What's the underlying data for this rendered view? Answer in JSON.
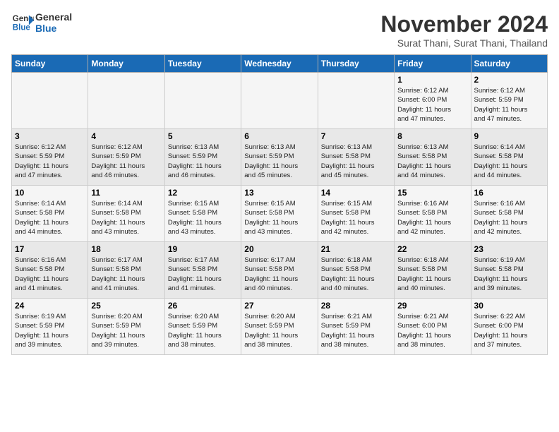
{
  "header": {
    "logo_line1": "General",
    "logo_line2": "Blue",
    "month": "November 2024",
    "location": "Surat Thani, Surat Thani, Thailand"
  },
  "days_of_week": [
    "Sunday",
    "Monday",
    "Tuesday",
    "Wednesday",
    "Thursday",
    "Friday",
    "Saturday"
  ],
  "weeks": [
    [
      {
        "day": "",
        "info": ""
      },
      {
        "day": "",
        "info": ""
      },
      {
        "day": "",
        "info": ""
      },
      {
        "day": "",
        "info": ""
      },
      {
        "day": "",
        "info": ""
      },
      {
        "day": "1",
        "info": "Sunrise: 6:12 AM\nSunset: 6:00 PM\nDaylight: 11 hours\nand 47 minutes."
      },
      {
        "day": "2",
        "info": "Sunrise: 6:12 AM\nSunset: 5:59 PM\nDaylight: 11 hours\nand 47 minutes."
      }
    ],
    [
      {
        "day": "3",
        "info": "Sunrise: 6:12 AM\nSunset: 5:59 PM\nDaylight: 11 hours\nand 47 minutes."
      },
      {
        "day": "4",
        "info": "Sunrise: 6:12 AM\nSunset: 5:59 PM\nDaylight: 11 hours\nand 46 minutes."
      },
      {
        "day": "5",
        "info": "Sunrise: 6:13 AM\nSunset: 5:59 PM\nDaylight: 11 hours\nand 46 minutes."
      },
      {
        "day": "6",
        "info": "Sunrise: 6:13 AM\nSunset: 5:59 PM\nDaylight: 11 hours\nand 45 minutes."
      },
      {
        "day": "7",
        "info": "Sunrise: 6:13 AM\nSunset: 5:58 PM\nDaylight: 11 hours\nand 45 minutes."
      },
      {
        "day": "8",
        "info": "Sunrise: 6:13 AM\nSunset: 5:58 PM\nDaylight: 11 hours\nand 44 minutes."
      },
      {
        "day": "9",
        "info": "Sunrise: 6:14 AM\nSunset: 5:58 PM\nDaylight: 11 hours\nand 44 minutes."
      }
    ],
    [
      {
        "day": "10",
        "info": "Sunrise: 6:14 AM\nSunset: 5:58 PM\nDaylight: 11 hours\nand 44 minutes."
      },
      {
        "day": "11",
        "info": "Sunrise: 6:14 AM\nSunset: 5:58 PM\nDaylight: 11 hours\nand 43 minutes."
      },
      {
        "day": "12",
        "info": "Sunrise: 6:15 AM\nSunset: 5:58 PM\nDaylight: 11 hours\nand 43 minutes."
      },
      {
        "day": "13",
        "info": "Sunrise: 6:15 AM\nSunset: 5:58 PM\nDaylight: 11 hours\nand 43 minutes."
      },
      {
        "day": "14",
        "info": "Sunrise: 6:15 AM\nSunset: 5:58 PM\nDaylight: 11 hours\nand 42 minutes."
      },
      {
        "day": "15",
        "info": "Sunrise: 6:16 AM\nSunset: 5:58 PM\nDaylight: 11 hours\nand 42 minutes."
      },
      {
        "day": "16",
        "info": "Sunrise: 6:16 AM\nSunset: 5:58 PM\nDaylight: 11 hours\nand 42 minutes."
      }
    ],
    [
      {
        "day": "17",
        "info": "Sunrise: 6:16 AM\nSunset: 5:58 PM\nDaylight: 11 hours\nand 41 minutes."
      },
      {
        "day": "18",
        "info": "Sunrise: 6:17 AM\nSunset: 5:58 PM\nDaylight: 11 hours\nand 41 minutes."
      },
      {
        "day": "19",
        "info": "Sunrise: 6:17 AM\nSunset: 5:58 PM\nDaylight: 11 hours\nand 41 minutes."
      },
      {
        "day": "20",
        "info": "Sunrise: 6:17 AM\nSunset: 5:58 PM\nDaylight: 11 hours\nand 40 minutes."
      },
      {
        "day": "21",
        "info": "Sunrise: 6:18 AM\nSunset: 5:58 PM\nDaylight: 11 hours\nand 40 minutes."
      },
      {
        "day": "22",
        "info": "Sunrise: 6:18 AM\nSunset: 5:58 PM\nDaylight: 11 hours\nand 40 minutes."
      },
      {
        "day": "23",
        "info": "Sunrise: 6:19 AM\nSunset: 5:58 PM\nDaylight: 11 hours\nand 39 minutes."
      }
    ],
    [
      {
        "day": "24",
        "info": "Sunrise: 6:19 AM\nSunset: 5:59 PM\nDaylight: 11 hours\nand 39 minutes."
      },
      {
        "day": "25",
        "info": "Sunrise: 6:20 AM\nSunset: 5:59 PM\nDaylight: 11 hours\nand 39 minutes."
      },
      {
        "day": "26",
        "info": "Sunrise: 6:20 AM\nSunset: 5:59 PM\nDaylight: 11 hours\nand 38 minutes."
      },
      {
        "day": "27",
        "info": "Sunrise: 6:20 AM\nSunset: 5:59 PM\nDaylight: 11 hours\nand 38 minutes."
      },
      {
        "day": "28",
        "info": "Sunrise: 6:21 AM\nSunset: 5:59 PM\nDaylight: 11 hours\nand 38 minutes."
      },
      {
        "day": "29",
        "info": "Sunrise: 6:21 AM\nSunset: 6:00 PM\nDaylight: 11 hours\nand 38 minutes."
      },
      {
        "day": "30",
        "info": "Sunrise: 6:22 AM\nSunset: 6:00 PM\nDaylight: 11 hours\nand 37 minutes."
      }
    ]
  ]
}
